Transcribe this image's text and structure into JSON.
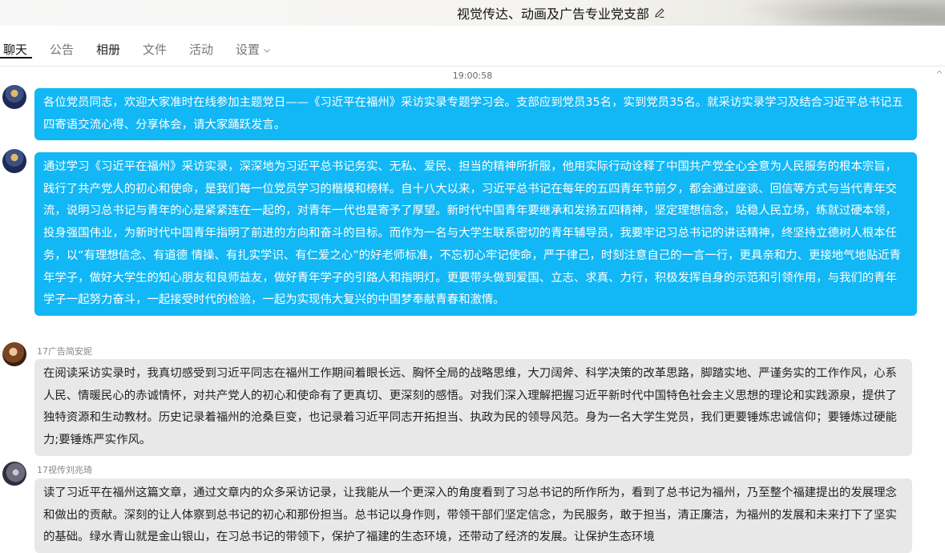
{
  "header": {
    "group_name": "视觉传达、动画及广告专业党支部"
  },
  "tabs": [
    {
      "label": "聊天",
      "active": true
    },
    {
      "label": "公告",
      "active": false
    },
    {
      "label": "相册",
      "active": false
    },
    {
      "label": "文件",
      "active": false
    },
    {
      "label": "活动",
      "active": false
    },
    {
      "label": "设置",
      "active": false
    }
  ],
  "chat": {
    "timestamp": "19:00:58",
    "messages": [
      {
        "sender": "",
        "text": "各位党员同志，欢迎大家准时在线参加主题党日——《习近平在福州》采访实录专题学习会。支部应到党员35名，实到党员35名。就采访实录学习及结合习近平总书记五四寄语交流心得、分享体会，请大家踊跃发言。"
      },
      {
        "sender": "",
        "text": "通过学习《习近平在福州》采访实录，深深地为习近平总书记务实、无私、爱民、担当的精神所折服，他用实际行动诠释了中国共产党全心全意为人民服务的根本宗旨，践行了共产党人的初心和使命，是我们每一位党员学习的楷模和榜样。自十八大以来，习近平总书记在每年的五四青年节前夕，都会通过座谈、回信等方式与当代青年交流，说明习总书记与青年的心是紧紧连在一起的，对青年一代也是寄予了厚望。新时代中国青年要继承和发扬五四精神，坚定理想信念，站稳人民立场，练就过硬本领，投身强国伟业，为新时代中国青年指明了前进的方向和奋斗的目标。而作为一名与大学生联系密切的青年辅导员，我要牢记习总书记的讲话精神，终坚持立德树人根本任务，以“有理想信念、有道德 情操、有扎实学识、有仁爱之心”的好老师标准，不忘初心牢记使命，严于律己，时刻注意自己的一言一行，更具亲和力、更接地气地贴近青年学子，做好大学生的知心朋友和良师益友，做好青年学子的引路人和指明灯。更要带头做到爱国、立志、求真、力行，积极发挥自身的示范和引领作用，与我们的青年学子一起努力奋斗，一起接受时代的检验，一起为实现伟大复兴的中国梦奉献青春和激情。"
      },
      {
        "sender": "17广告简安妮",
        "text": "在阅读采访实录时，我真切感受到习近平同志在福州工作期间着眼长远、胸怀全局的战略思维，大刀阔斧、科学决策的改革思路，脚踏实地、严谨务实的工作作风，心系人民、情暖民心的赤诚情怀，对共产党人的初心和使命有了更真切、更深刻的感悟。对我们深入理解把握习近平新时代中国特色社会主义思想的理论和实践源泉，提供了独特资源和生动教材。历史记录着福州的沧桑巨变，也记录着习近平同志开拓担当、执政为民的领导风范。身为一名大学生党员，我们更要锤炼忠诚信仰；要锤炼过硬能力;要锤炼严实作风。"
      },
      {
        "sender": "17视传刘兆琦",
        "text": "读了习近平在福州这篇文章，通过文章内的众多采访记录，让我能从一个更深入的角度看到了习总书记的所作所为，看到了总书记为福州，乃至整个福建提出的发展理念和做出的贡献。深刻的让人体察到总书记的初心和那份担当。总书记以身作则，带领干部们坚定信念，为民服务，敢于担当，清正廉洁，为福州的发展和未来打下了坚实的基础。绿水青山就是金山银山，在习总书记的带领下，保护了福建的生态环境，还带动了经济的发展。让保护生态环境"
      }
    ]
  }
}
